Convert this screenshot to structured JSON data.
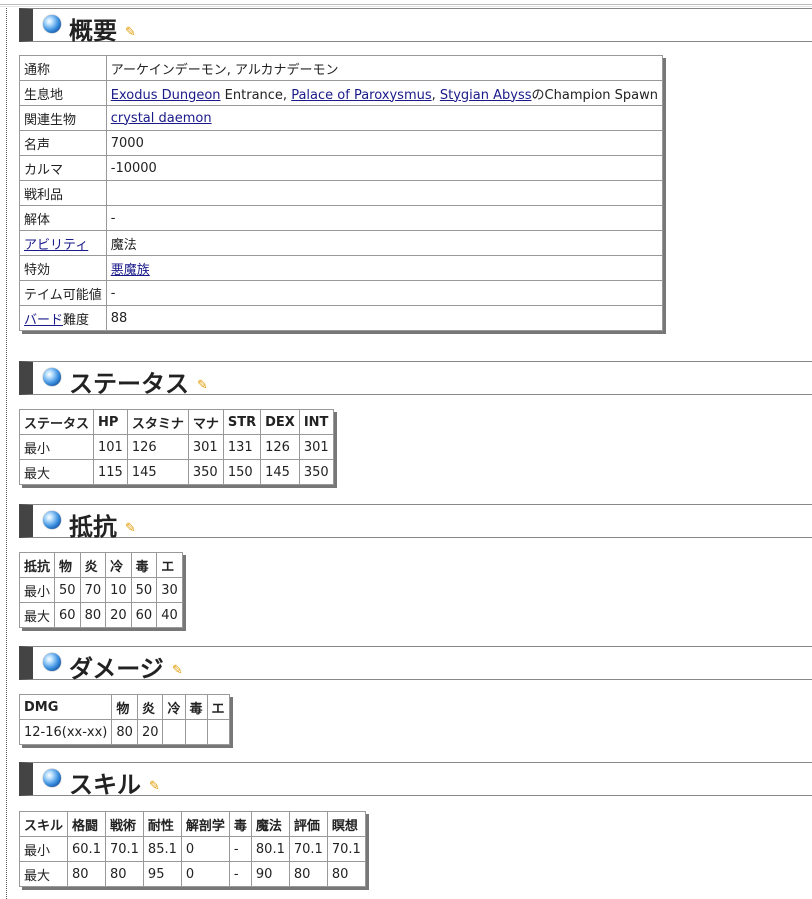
{
  "overview": {
    "title": "概要",
    "edit_glyph": "✎",
    "rows": [
      {
        "label": "通称",
        "value": "アーケインデーモン, アルカナデーモン"
      },
      {
        "label": "生息地",
        "link1": "Exodus Dungeon",
        "text1": " Entrance, ",
        "link2": "Palace of Paroxysmus",
        "text2": ", ",
        "link3": "Stygian Abyss",
        "text3": "のChampion Spawn"
      },
      {
        "label": "関連生物",
        "link": "crystal daemon"
      },
      {
        "label": "名声",
        "value": "7000"
      },
      {
        "label": "カルマ",
        "value": "-10000"
      },
      {
        "label": "戦利品",
        "value": ""
      },
      {
        "label": "解体",
        "value": "-"
      },
      {
        "label_link": "アビリティ",
        "value": "魔法"
      },
      {
        "label": "特効",
        "link": "悪魔族"
      },
      {
        "label": "テイム可能値",
        "value": "-"
      },
      {
        "label_link": "バード",
        "label_suffix": "難度",
        "value": "88"
      }
    ]
  },
  "status": {
    "title": "ステータス",
    "headers": [
      "ステータス",
      "HP",
      "スタミナ",
      "マナ",
      "STR",
      "DEX",
      "INT"
    ],
    "rows": [
      [
        "最小",
        "101",
        "126",
        "301",
        "131",
        "126",
        "301"
      ],
      [
        "最大",
        "115",
        "145",
        "350",
        "150",
        "145",
        "350"
      ]
    ]
  },
  "resist": {
    "title": "抵抗",
    "headers": [
      "抵抗",
      "物",
      "炎",
      "冷",
      "毒",
      "エ"
    ],
    "rows": [
      [
        "最小",
        "50",
        "70",
        "10",
        "50",
        "30"
      ],
      [
        "最大",
        "60",
        "80",
        "20",
        "60",
        "40"
      ]
    ]
  },
  "damage": {
    "title": "ダメージ",
    "headers": [
      "DMG",
      "物",
      "炎",
      "冷",
      "毒",
      "エ"
    ],
    "rows": [
      [
        "12-16(xx-xx)",
        "80",
        "20",
        "",
        "",
        ""
      ]
    ]
  },
  "skills": {
    "title": "スキル",
    "headers": [
      "スキル",
      "格闘",
      "戦術",
      "耐性",
      "解剖学",
      "毒",
      "魔法",
      "評価",
      "瞑想"
    ],
    "rows": [
      [
        "最小",
        "60.1",
        "70.1",
        "85.1",
        "0",
        "-",
        "80.1",
        "70.1",
        "70.1"
      ],
      [
        "最大",
        "80",
        "80",
        "95",
        "0",
        "-",
        "90",
        "80",
        "80"
      ]
    ]
  }
}
